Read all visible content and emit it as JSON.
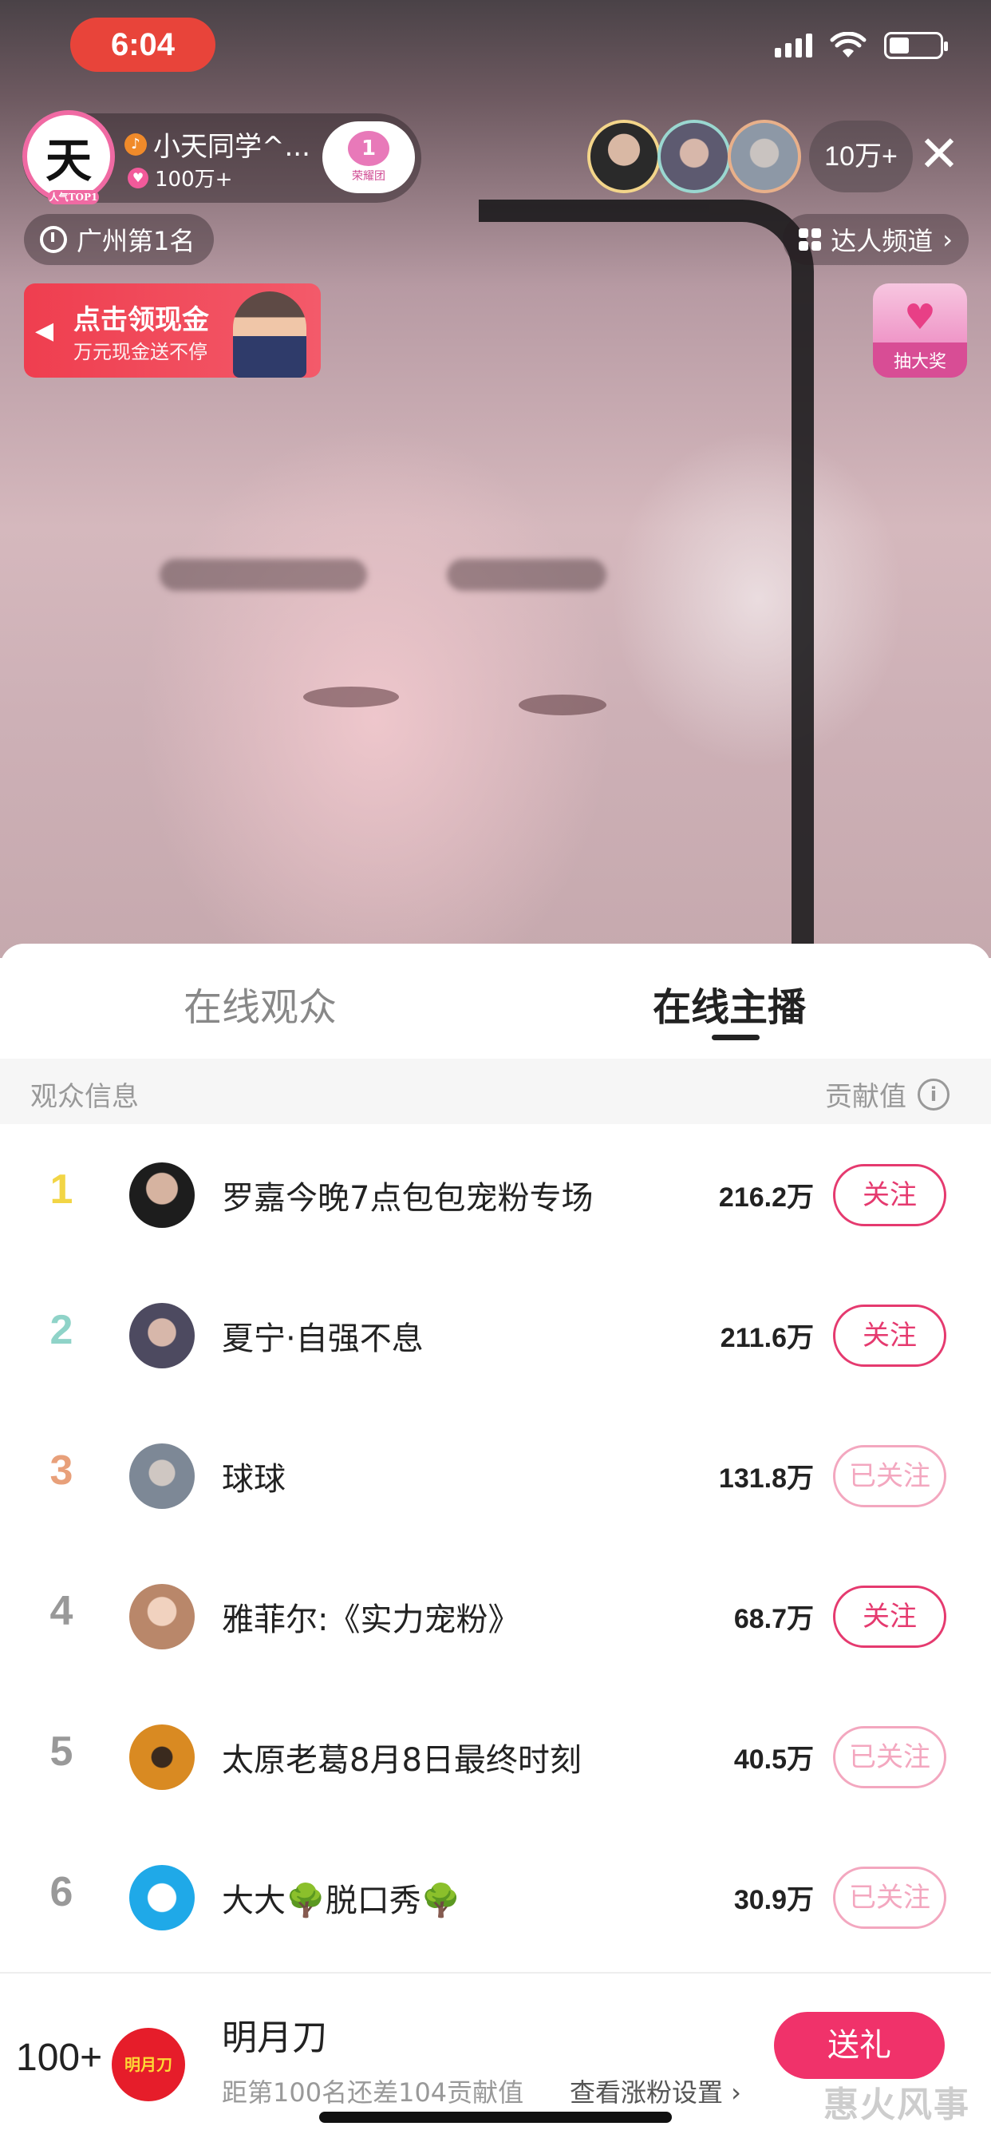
{
  "status_bar": {
    "time": "6:04"
  },
  "live": {
    "host_name": "小天同学^...",
    "host_avatar_char": "天",
    "host_avatar_tag": "人气TOP1",
    "host_likes": "100万+",
    "fan_club_level": "1",
    "fan_club_label": "荣耀团",
    "viewer_count": "10万+",
    "city_rank": "广州第1名",
    "channel_label": "达人频道",
    "cash_banner_title": "点击领现金",
    "cash_banner_subtitle": "万元现金送不停",
    "lottery_label": "抽大奖"
  },
  "tabs": {
    "audience": "在线观众",
    "hosts": "在线主播"
  },
  "list_header": {
    "left": "观众信息",
    "right": "贡献值"
  },
  "rows": [
    {
      "rank": "1",
      "rank_color": "#f2d545",
      "name": "罗嘉今晚7点包包宠粉专场",
      "score": "216.2万",
      "follow": "关注",
      "followed": false
    },
    {
      "rank": "2",
      "rank_color": "#8fd3c8",
      "name": "夏宁·自强不息",
      "score": "211.6万",
      "follow": "关注",
      "followed": false
    },
    {
      "rank": "3",
      "rank_color": "#e8a07a",
      "name": "球球",
      "score": "131.8万",
      "follow": "已关注",
      "followed": true
    },
    {
      "rank": "4",
      "rank_color": "#999999",
      "name": "雅菲尔:《实力宠粉》",
      "score": "68.7万",
      "follow": "关注",
      "followed": false
    },
    {
      "rank": "5",
      "rank_color": "#999999",
      "name": "太原老葛8月8日最终时刻",
      "score": "40.5万",
      "follow": "已关注",
      "followed": true
    },
    {
      "rank": "6",
      "rank_color": "#999999",
      "name": "大大🌳脱口秀🌳",
      "score": "30.9万",
      "follow": "已关注",
      "followed": true
    }
  ],
  "me": {
    "rank": "100+",
    "avatar_text": "明月刀",
    "name": "明月刀",
    "gap_text": "距第100名还差104贡献值",
    "link_text": "查看涨粉设置 ›",
    "gift_button": "送礼"
  },
  "watermark": "惠火风事"
}
